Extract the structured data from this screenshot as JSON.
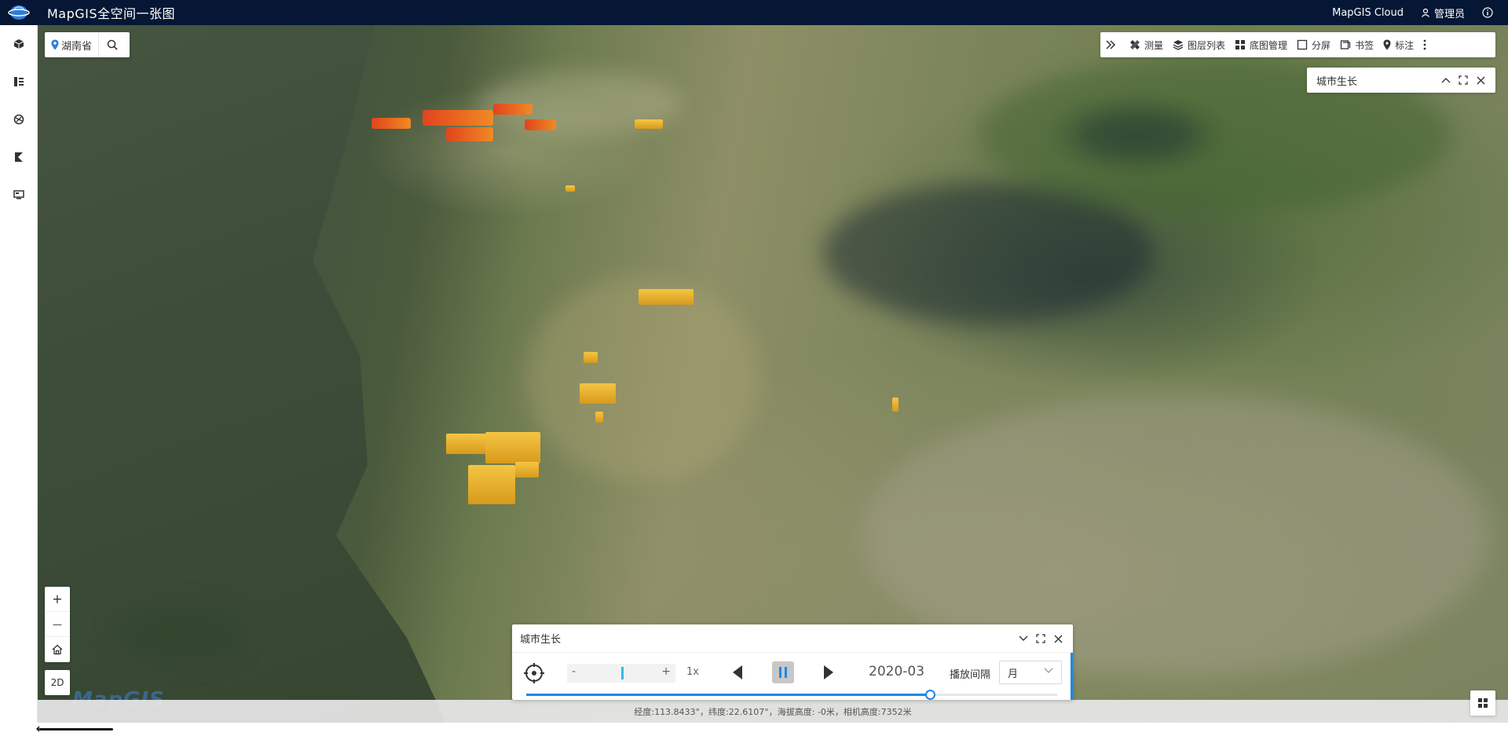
{
  "app": {
    "title": "MapGIS全空间一张图",
    "cloud_label": "MapGIS Cloud",
    "user_label": "管理员"
  },
  "rail": {
    "items": [
      "cube-icon",
      "layers-list-icon",
      "globe-tools-icon",
      "flag-icon",
      "monitor-icon"
    ]
  },
  "search": {
    "region": "湖南省"
  },
  "toolbar": {
    "items": [
      {
        "label": "测量",
        "icon": "ruler-icon"
      },
      {
        "label": "图层列表",
        "icon": "layers-icon"
      },
      {
        "label": "底图管理",
        "icon": "grid-icon"
      },
      {
        "label": "分屏",
        "icon": "square-icon"
      },
      {
        "label": "书签",
        "icon": "bookmark-icon"
      },
      {
        "label": "标注",
        "icon": "pin-icon"
      }
    ]
  },
  "panel_top": {
    "title": "城市生长"
  },
  "zoom": {
    "plus": "+",
    "minus": "—",
    "mode_2d": "2D"
  },
  "watermark": "MapGIS",
  "timeline": {
    "title": "城市生长",
    "speed_minus": "-",
    "speed_plus": "+",
    "speed_label": "1x",
    "current_date": "2020-03",
    "interval_label": "播放间隔",
    "interval_value": "月",
    "progress_fraction": 0.76
  },
  "status": {
    "text": "经度:113.8433°，纬度:22.6107°，海拔高度: -0米，相机高度:7352米"
  },
  "colors": {
    "topbar": "#051734",
    "accent": "#1e88e5",
    "building": "#f5c543",
    "hotspot": "#e1441d"
  }
}
